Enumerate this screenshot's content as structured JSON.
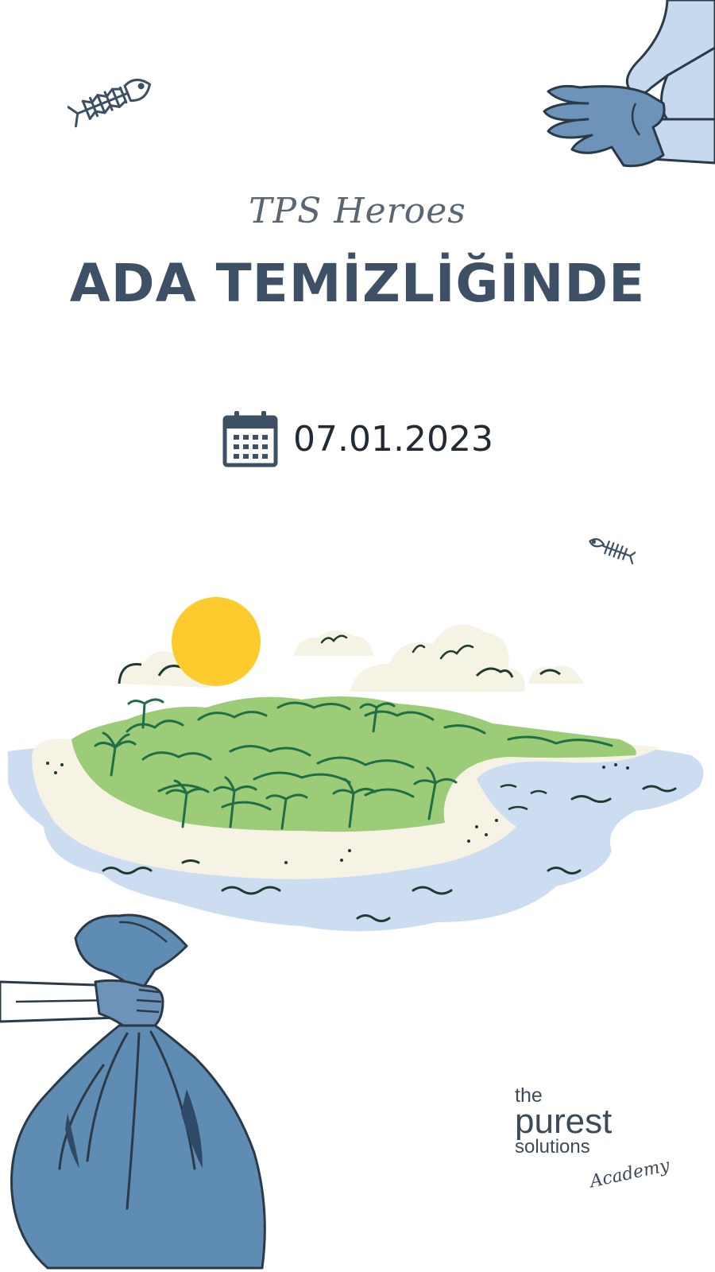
{
  "header": {
    "script_title": "TPS Heroes",
    "main_title": "ADA TEMİZLİĞİNDE"
  },
  "event": {
    "date": "07.01.2023",
    "date_icon": "calendar-icon"
  },
  "brand": {
    "the": "the",
    "purest": "purest",
    "solutions": "solutions",
    "academy": "Academy"
  },
  "illustration": {
    "icons": [
      "fish-bone-icon",
      "glove-hand-icon",
      "sun-icon",
      "cloud-icon",
      "bird-icon",
      "palm-tree-icon",
      "wave-icon",
      "trash-bag-icon"
    ],
    "colors": {
      "sun": "#FDCB2D",
      "sea": "#CCDDF2",
      "sand": "#F6F3E4",
      "island_green": "#9DCC78",
      "trees": "#1F6E46",
      "cloud": "#F5F3E3",
      "glove": "#6E93B8",
      "bag": "#5E8CB3",
      "outline": "#2B3A48"
    }
  }
}
